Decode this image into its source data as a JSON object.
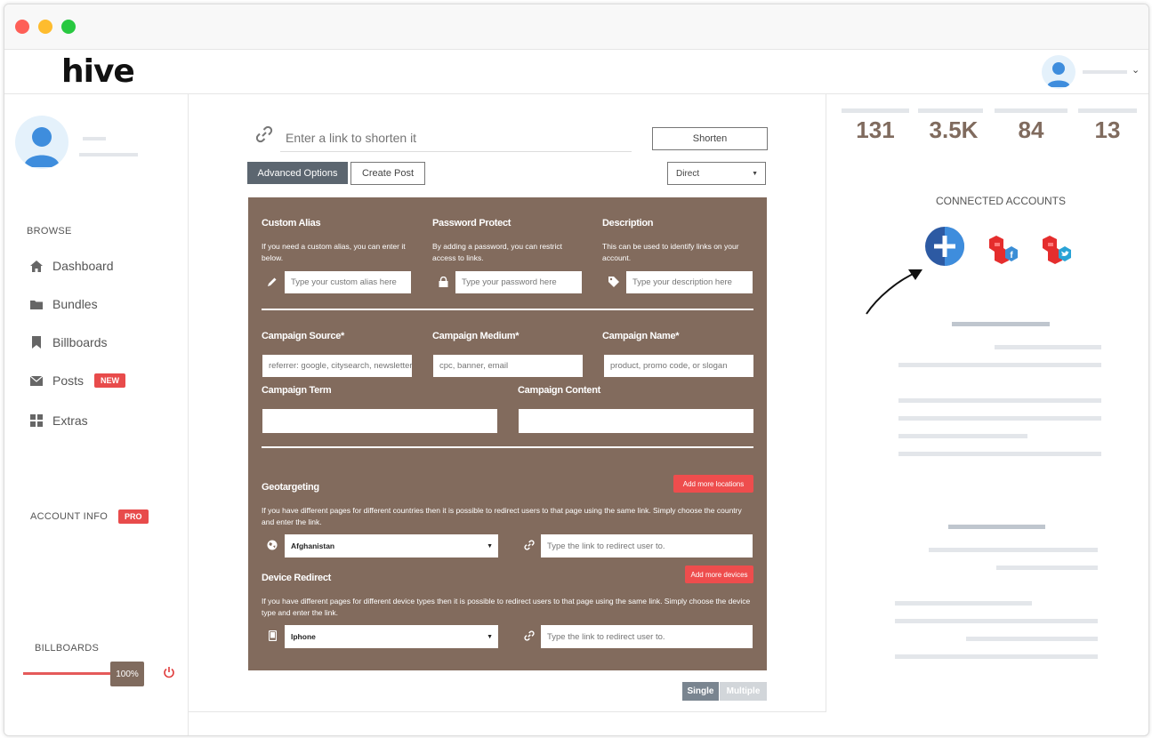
{
  "app": {
    "logo": "hive"
  },
  "colors": {
    "brand": "#826b5d",
    "accent": "#ee4d4d",
    "sidebar_blue": "#3e8ddd"
  },
  "sidebar": {
    "browse_title": "BROWSE",
    "items": [
      {
        "label": "Dashboard",
        "icon": "home-icon"
      },
      {
        "label": "Bundles",
        "icon": "folder-icon"
      },
      {
        "label": "Billboards",
        "icon": "bookmark-icon"
      },
      {
        "label": "Posts",
        "icon": "envelope-icon",
        "badge": "NEW"
      },
      {
        "label": "Extras",
        "icon": "grid-icon"
      }
    ],
    "account_info_title": "ACCOUNT INFO",
    "account_badge": "PRO",
    "billboards_title": "BILLBOARDS",
    "billboards_progress": "100%",
    "billboards_progress_value": 1.0
  },
  "shortener": {
    "placeholder": "Enter a link to shorten it",
    "shorten_label": "Shorten",
    "advanced_label": "Advanced Options",
    "create_post_label": "Create Post",
    "redirect_type": "Direct"
  },
  "panel": {
    "alias": {
      "label": "Custom Alias",
      "help": "If you need a custom alias, you can enter it below.",
      "placeholder": "Type your custom alias here"
    },
    "password": {
      "label": "Password Protect",
      "help": "By adding a password, you can restrict access to links.",
      "placeholder": "Type your password here"
    },
    "description": {
      "label": "Description",
      "help": "This can be used to identify links on your account.",
      "placeholder": "Type your description here"
    },
    "campaign_source": {
      "label": "Campaign Source*",
      "placeholder": "referrer: google, citysearch, newsletter"
    },
    "campaign_medium": {
      "label": "Campaign Medium*",
      "placeholder": "cpc, banner, email"
    },
    "campaign_name": {
      "label": "Campaign Name*",
      "placeholder": "product, promo code, or slogan"
    },
    "campaign_term": {
      "label": "Campaign Term"
    },
    "campaign_content": {
      "label": "Campaign Content"
    },
    "geo": {
      "label": "Geotargeting",
      "add_label": "Add more locations",
      "help": "If you have different pages for different countries then it is possible to redirect users to that page using the same link. Simply choose the country and enter the link.",
      "country": "Afghanistan",
      "link_placeholder": "Type the link to redirect user to."
    },
    "device": {
      "label": "Device Redirect",
      "add_label": "Add more devices",
      "help": "If you have different pages for different device types then it is possible to redirect users to that page using the same link. Simply choose the device type and enter the link.",
      "device": "Iphone",
      "link_placeholder": "Type the link to redirect user to."
    }
  },
  "toggle": {
    "single": "Single",
    "multiple": "Multiple"
  },
  "stats": [
    "131",
    "3.5K",
    "84",
    "13"
  ],
  "connected": {
    "title": "CONNECTED ACCOUNTS"
  }
}
